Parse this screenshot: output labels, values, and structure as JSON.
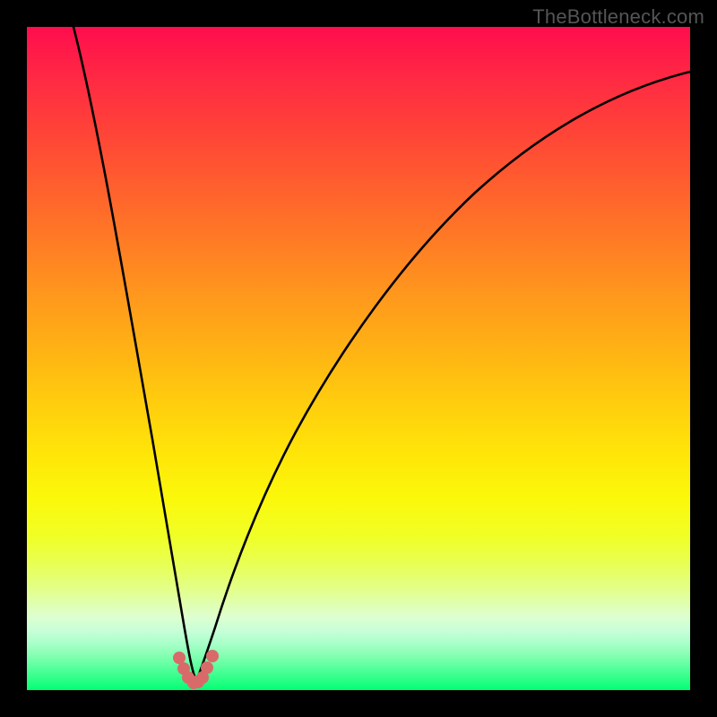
{
  "watermark": "TheBottleneck.com",
  "chart_data": {
    "type": "line",
    "title": "",
    "xlabel": "",
    "ylabel": "",
    "xlim": [
      0,
      100
    ],
    "ylim": [
      0,
      100
    ],
    "grid": false,
    "gradient": {
      "direction": "vertical",
      "stops": [
        {
          "pos": 0,
          "color": "#ff0d4d",
          "meaning": "high-bottleneck"
        },
        {
          "pos": 50,
          "color": "#ffc010",
          "meaning": "mid"
        },
        {
          "pos": 90,
          "color": "#ddffd0",
          "meaning": "transition"
        },
        {
          "pos": 100,
          "color": "#00ff76",
          "meaning": "no-bottleneck"
        }
      ]
    },
    "series": [
      {
        "name": "bottleneck-curve",
        "x": [
          7,
          10,
          13,
          16,
          19,
          21,
          23,
          25,
          27,
          30,
          33,
          38,
          45,
          55,
          65,
          75,
          85,
          95,
          100
        ],
        "y": [
          100,
          82,
          62,
          44,
          28,
          16,
          7,
          2,
          2,
          7,
          15,
          27,
          42,
          58,
          70,
          79,
          85,
          89,
          91
        ]
      }
    ],
    "markers": {
      "name": "optimal-region",
      "color": "#d96a6a",
      "x": [
        23.0,
        23.7,
        24.4,
        25.1,
        25.1,
        25.8,
        26.5,
        27.2,
        28.0
      ],
      "y": [
        5.0,
        3.0,
        1.6,
        1.1,
        1.0,
        1.1,
        1.8,
        3.2,
        5.2
      ]
    }
  }
}
